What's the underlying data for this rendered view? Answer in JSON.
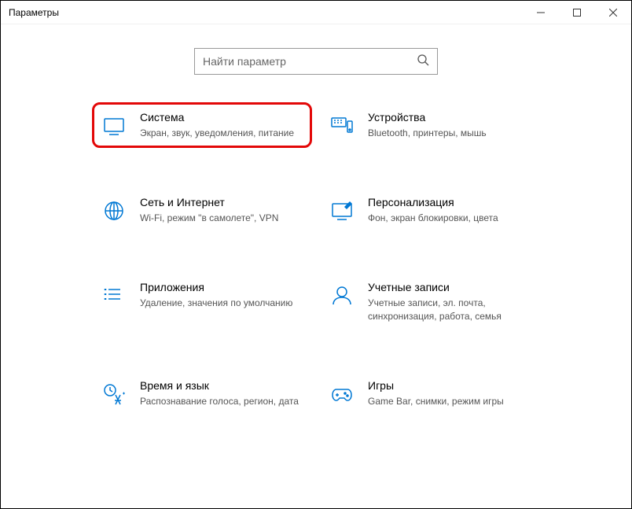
{
  "window": {
    "title": "Параметры"
  },
  "search": {
    "placeholder": "Найти параметр"
  },
  "tiles": [
    {
      "title": "Система",
      "desc": "Экран, звук, уведомления, питание"
    },
    {
      "title": "Устройства",
      "desc": "Bluetooth, принтеры, мышь"
    },
    {
      "title": "Сеть и Интернет",
      "desc": "Wi-Fi, режим \"в самолете\", VPN"
    },
    {
      "title": "Персонализация",
      "desc": "Фон, экран блокировки, цвета"
    },
    {
      "title": "Приложения",
      "desc": "Удаление, значения по умолчанию"
    },
    {
      "title": "Учетные записи",
      "desc": "Учетные записи, эл. почта, синхронизация, работа, семья"
    },
    {
      "title": "Время и язык",
      "desc": "Распознавание голоса, регион, дата"
    },
    {
      "title": "Игры",
      "desc": "Game Bar, снимки, режим игры"
    }
  ]
}
